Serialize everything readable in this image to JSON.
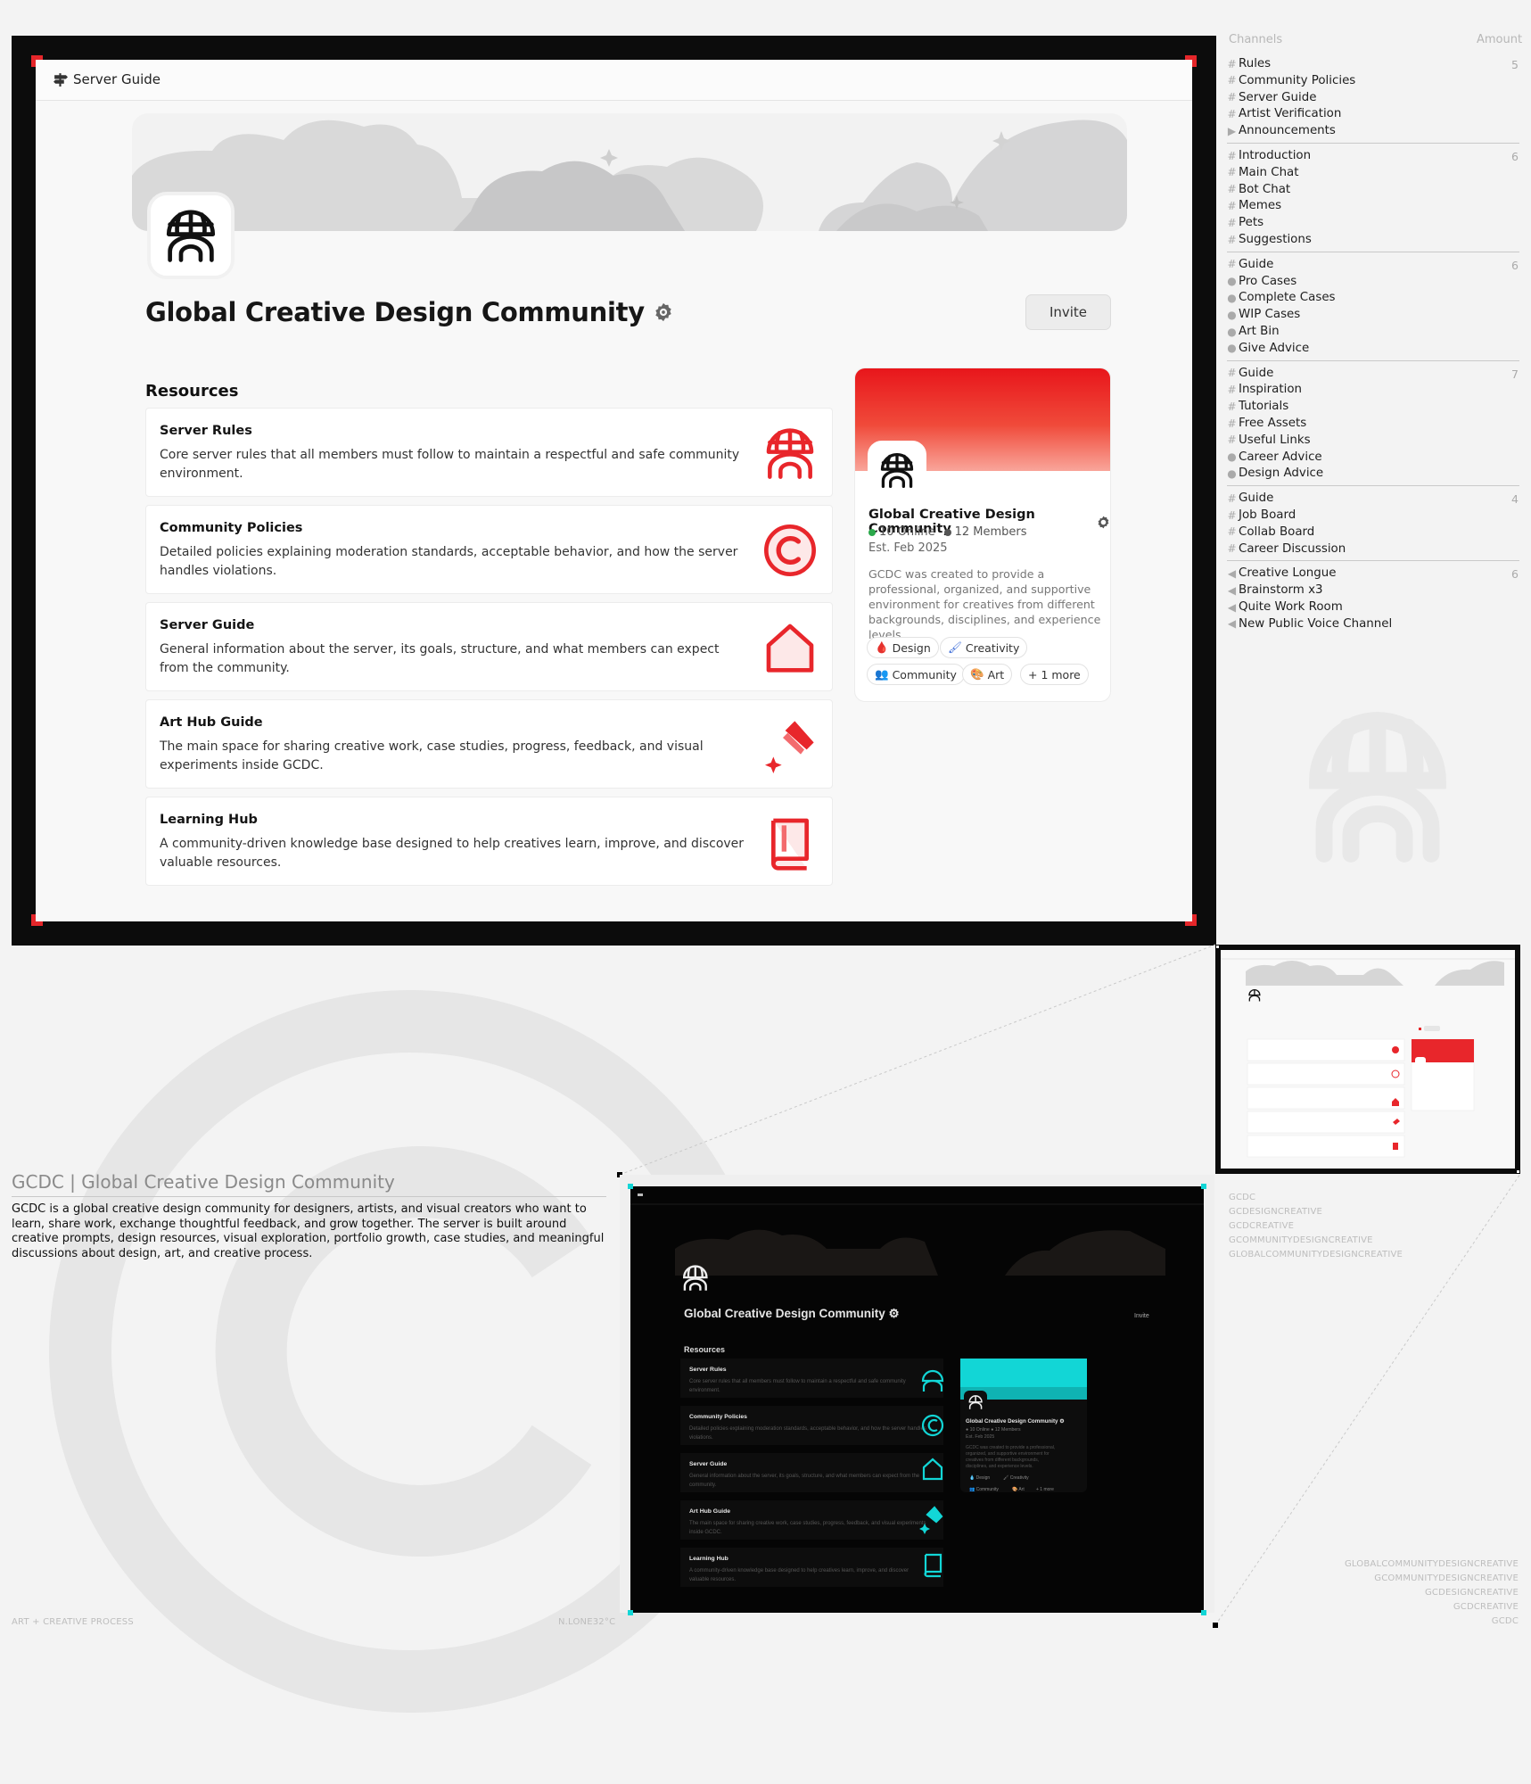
{
  "topbar": {
    "label": "Server Guide"
  },
  "server": {
    "name": "Global Creative Design Community",
    "invite": "Invite",
    "logo": "globe-arch-icon",
    "verified": "gear-badge-icon"
  },
  "resources": {
    "heading": "Resources",
    "items": [
      {
        "title": "Server Rules",
        "desc": "Core server rules that all members must follow to maintain a respectful and safe community environment.",
        "icon": "globe-arch-icon"
      },
      {
        "title": "Community Policies",
        "desc": "Detailed policies explaining moderation standards, acceptable behavior, and how the server handles violations.",
        "icon": "copyright-icon"
      },
      {
        "title": "Server Guide",
        "desc": "General information about the server, its goals, structure, and what members can expect from the community.",
        "icon": "house-icon"
      },
      {
        "title": "Art Hub Guide",
        "desc": "The main space for sharing creative work, case studies, progress, feedback, and visual experiments inside GCDC.",
        "icon": "paint-brush-icon"
      },
      {
        "title": "Learning Hub",
        "desc": "A community-driven knowledge base designed to help creatives learn, improve, and discover valuable resources.",
        "icon": "book-icon"
      }
    ]
  },
  "profile": {
    "name": "Global Creative Design Community",
    "online": "10 Online",
    "members": "12 Members",
    "est": "Est. Feb 2025",
    "desc": "GCDC was created to provide a professional, organized, and supportive environment for creatives from different backgrounds, disciplines, and experience levels.",
    "tags": [
      "Design",
      "Creativity",
      "Community",
      "Art",
      "+ 1 more"
    ],
    "colors": {
      "online": "#2aa84a",
      "members": "#555555",
      "accent_light": "#e8161b",
      "accent_dark": "#12d6d6"
    }
  },
  "channels": {
    "header_left": "Channels",
    "header_right": "Amount",
    "groups": [
      {
        "count": "5",
        "items": [
          {
            "g": "#",
            "n": "Rules"
          },
          {
            "g": "#",
            "n": "Community Policies"
          },
          {
            "g": "#",
            "n": "Server Guide"
          },
          {
            "g": "#",
            "n": "Artist Verification"
          },
          {
            "g": "▶",
            "n": "Announcements"
          }
        ]
      },
      {
        "count": "6",
        "items": [
          {
            "g": "#",
            "n": "Introduction"
          },
          {
            "g": "#",
            "n": "Main Chat"
          },
          {
            "g": "#",
            "n": "Bot Chat"
          },
          {
            "g": "#",
            "n": "Memes"
          },
          {
            "g": "#",
            "n": "Pets"
          },
          {
            "g": "#",
            "n": "Suggestions"
          }
        ]
      },
      {
        "count": "6",
        "items": [
          {
            "g": "#",
            "n": "Guide"
          },
          {
            "g": "●",
            "n": "Pro Cases"
          },
          {
            "g": "●",
            "n": "Complete Cases"
          },
          {
            "g": "●",
            "n": "WIP Cases"
          },
          {
            "g": "●",
            "n": "Art Bin"
          },
          {
            "g": "●",
            "n": "Give Advice"
          }
        ]
      },
      {
        "count": "7",
        "items": [
          {
            "g": "#",
            "n": "Guide"
          },
          {
            "g": "#",
            "n": "Inspiration"
          },
          {
            "g": "#",
            "n": "Tutorials"
          },
          {
            "g": "#",
            "n": "Free Assets"
          },
          {
            "g": "#",
            "n": "Useful Links"
          },
          {
            "g": "●",
            "n": "Career Advice"
          },
          {
            "g": "●",
            "n": "Design Advice"
          }
        ]
      },
      {
        "count": "4",
        "items": [
          {
            "g": "#",
            "n": "Guide"
          },
          {
            "g": "#",
            "n": "Job Board"
          },
          {
            "g": "#",
            "n": "Collab Board"
          },
          {
            "g": "#",
            "n": "Career Discussion"
          }
        ]
      },
      {
        "count": "6",
        "items": [
          {
            "g": "◀",
            "n": "Creative Longue"
          },
          {
            "g": "◀",
            "n": "Brainstorm x3"
          },
          {
            "g": "◀",
            "n": "Quite Work Room"
          },
          {
            "g": "◀",
            "n": "New Public Voice Channel"
          }
        ]
      }
    ]
  },
  "caption": {
    "title": "GCDC | Global Creative Design Community",
    "body": "GCDC is a global creative design community for designers, artists, and  visual creators who want to learn, share work, exchange thoughtful  feedback, and grow together. The server is built around creative  prompts, design resources, visual exploration, portfolio growth, case  studies, and meaningful discussions about design, art, and creative  process.",
    "footer_left": "ART + CREATIVE PROCESS",
    "footer_right": "N.LONE32°C"
  },
  "wordmarks_left": [
    "GCDC",
    "GCDESIGNCREATIVE",
    "GCDCREATIVE",
    "GCOMMUNITYDESIGNCREATIVE",
    "GLOBALCOMMUNITYDESIGNCREATIVE"
  ],
  "wordmarks_right": [
    "GLOBALCOMMUNITYDESIGNCREATIVE",
    "GCOMMUNITYDESIGNCREATIVE",
    "GCDESIGNCREATIVE",
    "GCDCREATIVE",
    "GCDC"
  ]
}
